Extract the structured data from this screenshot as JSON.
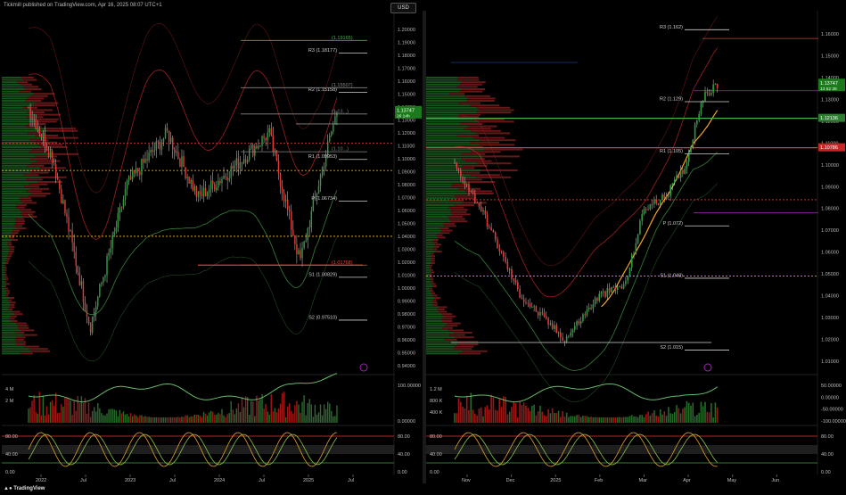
{
  "header": {
    "publisher": "Tickmill published on TradingView.com, Apr 16, 2025 08:07 UTC+1"
  },
  "footer": {
    "brand": "TradingView"
  },
  "left": {
    "currency": "USD",
    "price_axis": [
      "1.20000",
      "1.19000",
      "1.18000",
      "1.17000",
      "1.16000",
      "1.15000",
      "1.14000",
      "1.13000",
      "1.12000",
      "1.11000",
      "1.10000",
      "1.09000",
      "1.08000",
      "1.07000",
      "1.06000",
      "1.05000",
      "1.04000",
      "1.03000",
      "1.02000",
      "1.01000",
      "1.00000",
      "0.99000",
      "0.98000",
      "0.97000",
      "0.96000",
      "0.95000",
      "0.94000"
    ],
    "price_badge": {
      "value": "1.13747",
      "sub": "26 14h"
    },
    "pivots": [
      {
        "label": "R3 (1.18177)",
        "price": 1.18177
      },
      {
        "label": "R2 (1.15158)",
        "price": 1.15158
      },
      {
        "label": "R1 (1.09953)",
        "price": 1.09953
      },
      {
        "label": "P (1.06734)",
        "price": 1.06734
      },
      {
        "label": "S1 (1.00829)",
        "price": 1.00829
      },
      {
        "label": "S2 (0.97510)",
        "price": 0.9751
      }
    ],
    "fib_labels": [
      {
        "label": "(1.19165)",
        "price": 1.19165,
        "color": "#4caf50"
      },
      {
        "label": "(1.15507)",
        "price": 1.15507,
        "color": "#888888"
      },
      {
        "label": "(1.13...)",
        "price": 1.1347,
        "color": "#888888"
      },
      {
        "label": "(1.10...)",
        "price": 1.1055,
        "color": "#888888"
      },
      {
        "label": "(1.01768)",
        "price": 1.01768,
        "color": "#f44336"
      }
    ],
    "volume_axis": [
      "4 M",
      "2 M"
    ],
    "volume_right": [
      "100.00000",
      "0.00000"
    ],
    "osc_axis": [
      "80.00",
      "40.00",
      "0.00"
    ],
    "time_axis": [
      "2022",
      "Jul",
      "2023",
      "Jul",
      "2024",
      "Jul",
      "2025",
      "Jul"
    ]
  },
  "right": {
    "price_axis": [
      "1.16000",
      "1.15000",
      "1.14000",
      "1.13000",
      "1.12000",
      "1.11000",
      "1.10000",
      "1.09000",
      "1.08000",
      "1.07000",
      "1.06000",
      "1.05000",
      "1.04000",
      "1.03000",
      "1.02000",
      "1.01000"
    ],
    "price_badges": [
      {
        "value": "1.13747",
        "sub": "13 52 39",
        "color": "#1b7a1b"
      },
      {
        "value": "1.12136",
        "sub": "",
        "color": "#2e7d32"
      },
      {
        "value": "1.10786",
        "sub": "",
        "color": "#c62828"
      }
    ],
    "pivots": [
      {
        "label": "R3 (1.162)",
        "price": 1.162
      },
      {
        "label": "R2 (1.129)",
        "price": 1.129
      },
      {
        "label": "R1 (1.105)",
        "price": 1.105
      },
      {
        "label": "P (1.072)",
        "price": 1.072
      },
      {
        "label": "S1 (1.048)",
        "price": 1.048
      },
      {
        "label": "S2 (1.015)",
        "price": 1.015
      }
    ],
    "volume_axis": [
      "1.2 M",
      "800 K",
      "400 K"
    ],
    "volume_right": [
      "50.00000",
      "0.00000",
      "-50.00000",
      "-100.00000"
    ],
    "osc_axis": [
      "80.00",
      "40.00",
      "0.00"
    ],
    "time_axis": [
      "Nov",
      "Dec",
      "2025",
      "Feb",
      "Mar",
      "Apr",
      "May",
      "Jun"
    ]
  },
  "colors": {
    "up": "#26a69a",
    "green": "#2e9e3e",
    "down": "#e53935",
    "bg": "#000000"
  }
}
